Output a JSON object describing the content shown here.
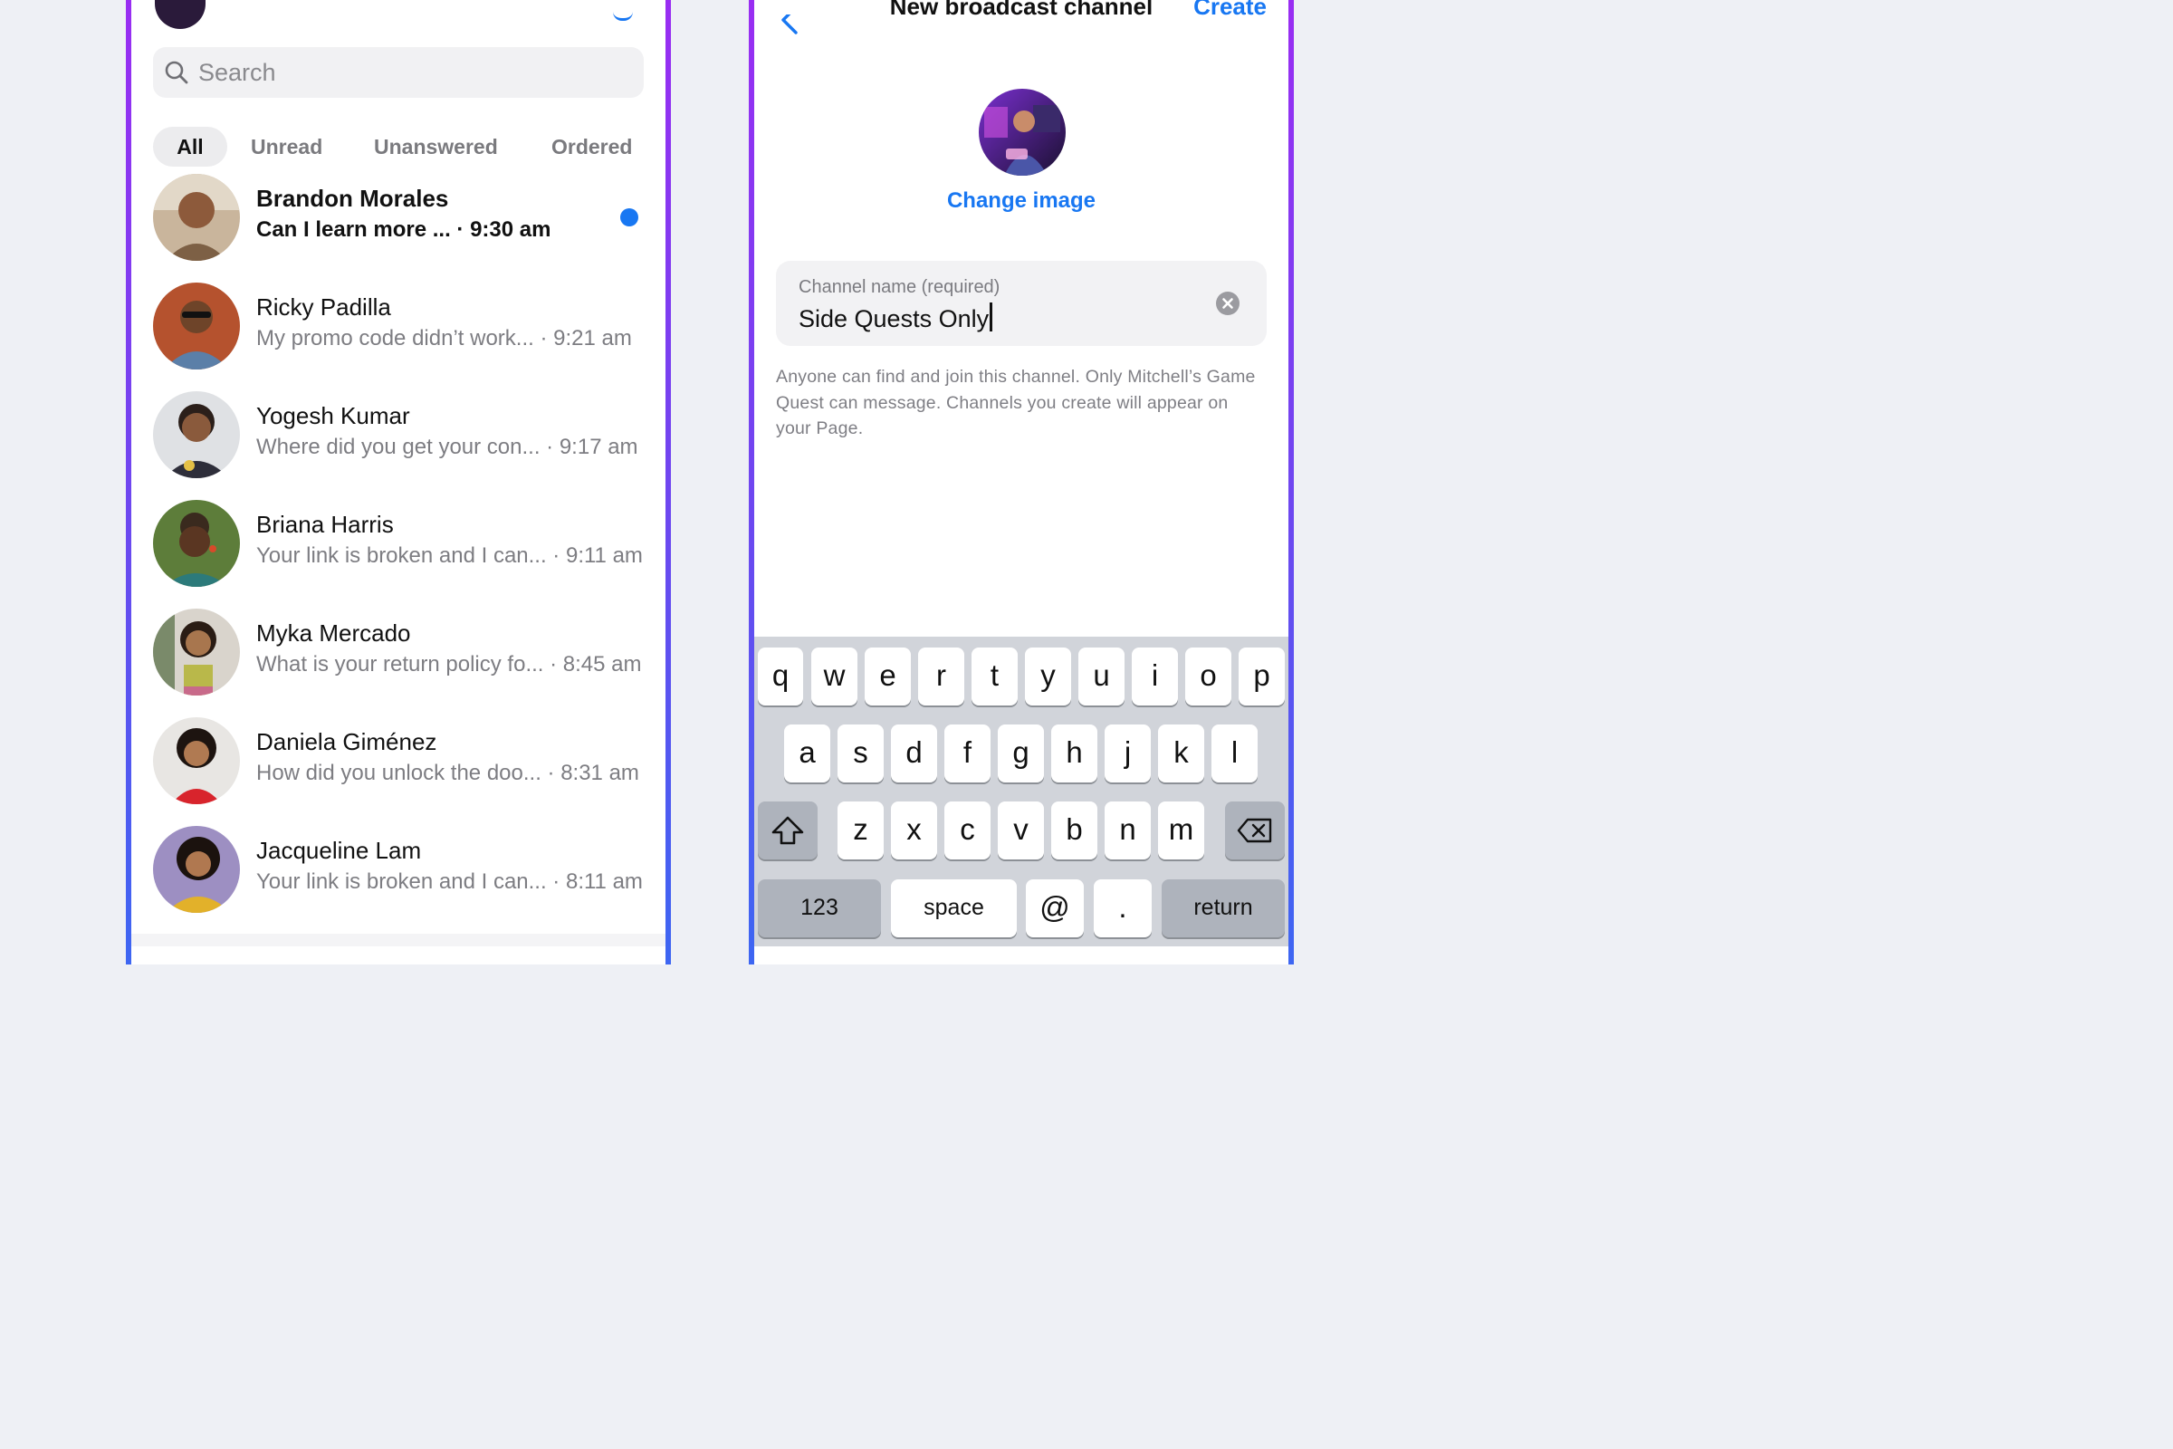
{
  "left_screen": {
    "search": {
      "placeholder": "Search"
    },
    "filters": [
      "All",
      "Unread",
      "Unanswered",
      "Ordered"
    ],
    "chats": [
      {
        "name": "Brandon Morales",
        "preview": "Can I learn more ... · 9:30 am",
        "unread": true
      },
      {
        "name": "Ricky Padilla",
        "preview": "My promo code didn’t work... · 9:21 am",
        "unread": false
      },
      {
        "name": "Yogesh Kumar",
        "preview": "Where did you get your con... · 9:17 am",
        "unread": false
      },
      {
        "name": "Briana Harris",
        "preview": "Your link is broken and I can... · 9:11 am",
        "unread": false
      },
      {
        "name": "Myka Mercado",
        "preview": "What is your return policy fo... · 8:45 am",
        "unread": false
      },
      {
        "name": "Daniela Giménez",
        "preview": "How did you unlock the doo... · 8:31 am",
        "unread": false
      },
      {
        "name": "Jacqueline Lam",
        "preview": "Your link is broken and I can... · 8:11 am",
        "unread": false
      }
    ]
  },
  "right_screen": {
    "nav": {
      "title": "New broadcast channel",
      "create_label": "Create"
    },
    "change_image_label": "Change image",
    "field": {
      "label": "Channel name (required)",
      "value": "Side Quests Only"
    },
    "helper_text": "Anyone can find and join this channel. Only Mitchell’s Game Quest can message. Channels you create will appear on your Page.",
    "keyboard": {
      "row1": [
        "q",
        "w",
        "e",
        "r",
        "t",
        "y",
        "u",
        "i",
        "o",
        "p"
      ],
      "row2": [
        "a",
        "s",
        "d",
        "f",
        "g",
        "h",
        "j",
        "k",
        "l"
      ],
      "row3": [
        "z",
        "x",
        "c",
        "v",
        "b",
        "n",
        "m"
      ],
      "numbers_label": "123",
      "space_label": "space",
      "at_label": "@",
      "dot_label": ".",
      "return_label": "return"
    }
  },
  "colors": {
    "accent": "#1877f2",
    "frame_top": "#9b2cf2",
    "frame_bottom": "#3d66f2",
    "keyboard_bg": "#d1d4da"
  }
}
